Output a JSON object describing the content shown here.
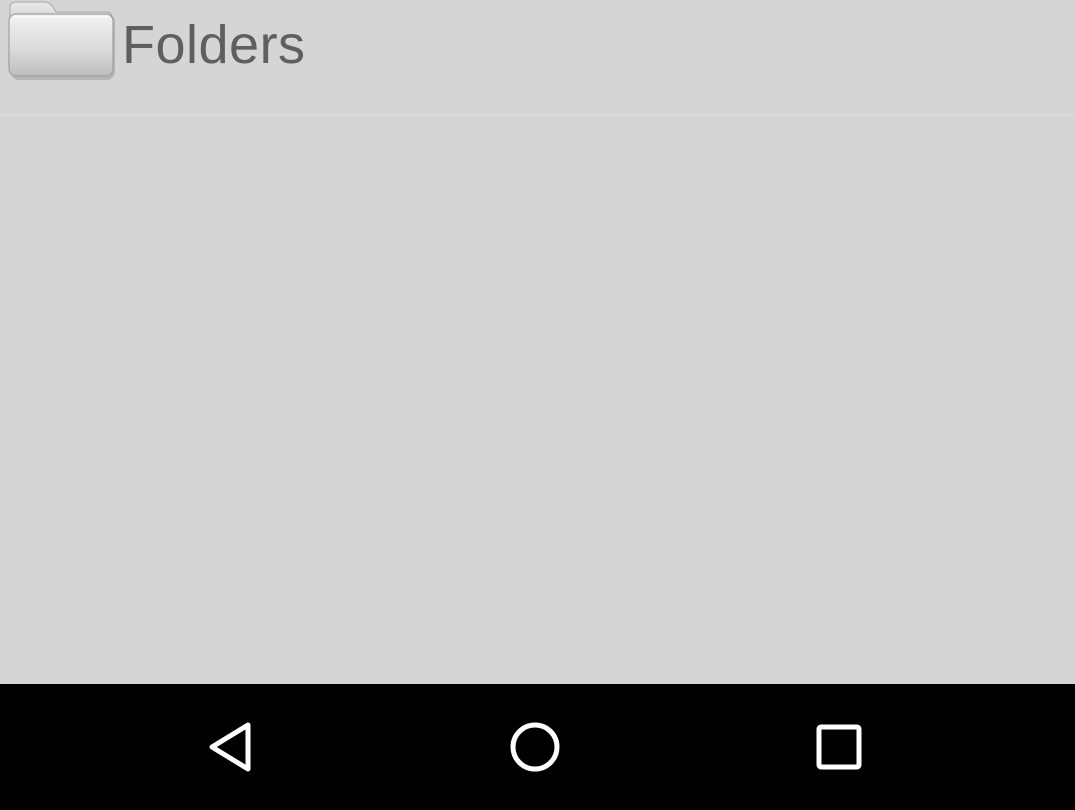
{
  "header": {
    "title": "Folders",
    "icon": "folder-icon"
  },
  "navbar": {
    "back_icon": "back-triangle-icon",
    "home_icon": "home-circle-icon",
    "recent_icon": "recent-apps-square-icon"
  },
  "colors": {
    "background": "#d4d4d4",
    "title_text": "#5f5f5f",
    "navbar": "#000000",
    "nav_icon": "#ffffff"
  }
}
